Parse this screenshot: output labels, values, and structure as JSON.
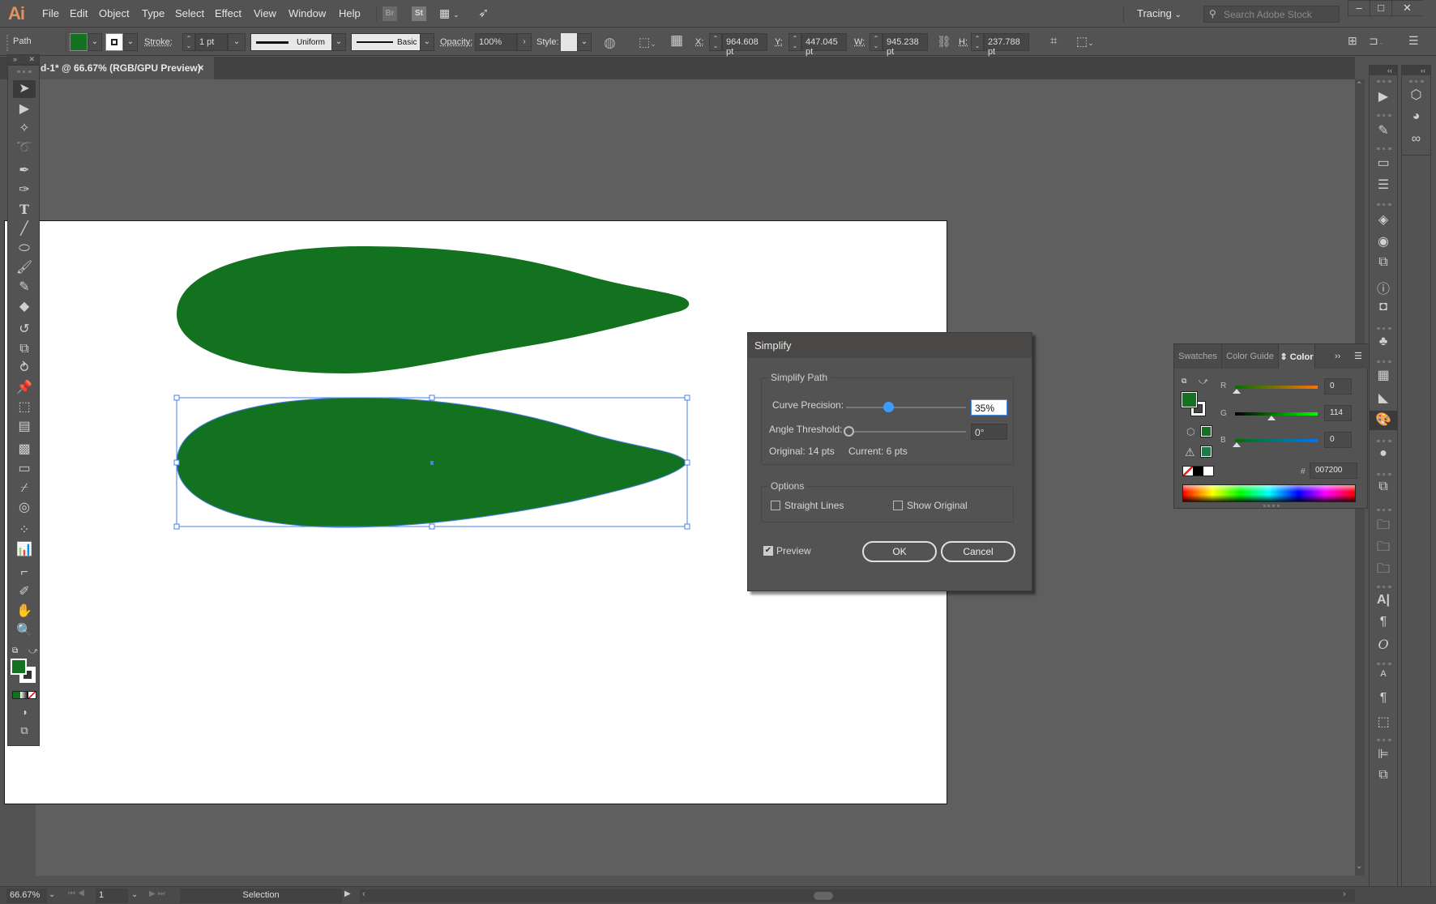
{
  "app": {
    "logo": "Ai",
    "menu": [
      "File",
      "Edit",
      "Object",
      "Type",
      "Select",
      "Effect",
      "View",
      "Window",
      "Help"
    ],
    "bridge_label": "Br",
    "stock_label": "St",
    "workspace": "Tracing",
    "search_placeholder": "Search Adobe Stock",
    "window_controls": [
      "minimize",
      "maximize",
      "close"
    ]
  },
  "control_bar": {
    "selection_type": "Path",
    "fill_color": "#137220",
    "stroke_label": "Stroke:",
    "stroke_weight": "1 pt",
    "variable_width_profile": "Uniform",
    "brush_definition": "Basic",
    "opacity_label": "Opacity:",
    "opacity": "100%",
    "style_label": "Style:",
    "x_label": "X:",
    "x": "964.608 pt",
    "y_label": "Y:",
    "y": "447.045 pt",
    "w_label": "W:",
    "w": "945.238 pt",
    "h_label": "H:",
    "h": "237.788 pt"
  },
  "document_tab": {
    "title": "d-1* @ 66.67% (RGB/GPU Preview)",
    "close": "×"
  },
  "artboard": {
    "shape_color": "#13721f",
    "selection_color": "#4a7fe8"
  },
  "simplify_dialog": {
    "title": "Simplify",
    "group_path": "Simplify Path",
    "curve_precision_label": "Curve Precision:",
    "curve_precision_value": "35%",
    "curve_precision_fraction": 0.35,
    "angle_threshold_label": "Angle Threshold:",
    "angle_threshold_value": "0°",
    "angle_threshold_fraction": 0,
    "original_points": "Original: 14 pts",
    "current_points": "Current: 6 pts",
    "group_options": "Options",
    "straight_lines_label": "Straight Lines",
    "straight_lines_checked": false,
    "show_original_label": "Show Original",
    "show_original_checked": false,
    "preview_label": "Preview",
    "preview_checked": true,
    "ok_label": "OK",
    "cancel_label": "Cancel"
  },
  "color_panel": {
    "tabs": [
      "Swatches",
      "Color Guide",
      "Color"
    ],
    "active_tab": "Color",
    "r_label": "R",
    "r": "0",
    "g_label": "G",
    "g": "114",
    "b_label": "B",
    "b": "0",
    "hash_label": "#",
    "hex": "007200",
    "fill_color": "#137220",
    "gamut_color": "#1f7a4a"
  },
  "status_bar": {
    "zoom": "66.67%",
    "artboard_number": "1",
    "tool": "Selection"
  }
}
